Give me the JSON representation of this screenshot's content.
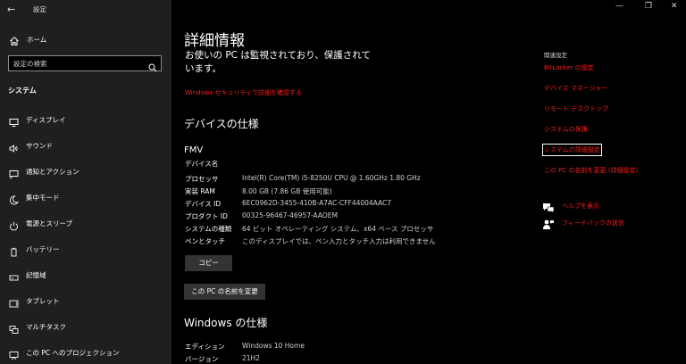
{
  "window": {
    "app_title": "設定",
    "back_glyph": "←",
    "minimize_glyph": "—",
    "maximize_glyph": "❐",
    "close_glyph": "✕"
  },
  "sidebar": {
    "home_label": "ホーム",
    "search_placeholder": "設定の検索",
    "section_title": "システム",
    "items": [
      {
        "label": "ディスプレイ",
        "icon": "display-icon"
      },
      {
        "label": "サウンド",
        "icon": "sound-icon"
      },
      {
        "label": "通知とアクション",
        "icon": "notification-icon"
      },
      {
        "label": "集中モード",
        "icon": "focus-moon-icon"
      },
      {
        "label": "電源とスリープ",
        "icon": "power-icon"
      },
      {
        "label": "バッテリー",
        "icon": "battery-icon"
      },
      {
        "label": "記憶域",
        "icon": "storage-icon"
      },
      {
        "label": "タブレット",
        "icon": "tablet-icon"
      },
      {
        "label": "マルチタスク",
        "icon": "multitask-icon"
      },
      {
        "label": "この PC へのプロジェクション",
        "icon": "projection-icon"
      }
    ]
  },
  "main": {
    "title": "詳細情報",
    "protect_text": "お使いの PC は監視されており、保護されています。",
    "security_link": "Windows セキュリティで詳細を確認する",
    "device_spec_title": "デバイスの仕様",
    "device_name": "FMV",
    "device_name_label": "デバイス名",
    "specs": [
      {
        "key": "プロセッサ",
        "value": "Intel(R) Core(TM) i5-8250U CPU @ 1.60GHz   1.80 GHz"
      },
      {
        "key": "実装 RAM",
        "value": "8.00 GB (7.86 GB 使用可能)"
      },
      {
        "key": "デバイス ID",
        "value": "6EC0962D-3455-410B-A7AC-CFF44004AAC7"
      },
      {
        "key": "プロダクト ID",
        "value": "00325-96467-46957-AAOEM"
      },
      {
        "key": "システムの種類",
        "value": "64 ビット オペレーティング システム、x64 ベース プロセッサ"
      },
      {
        "key": "ペンとタッチ",
        "value": "このディスプレイでは、ペン入力とタッチ入力は利用できません"
      }
    ],
    "copy_button": "コピー",
    "rename_button": "この PC の名前を変更",
    "windows_spec_title": "Windows の仕様",
    "win_specs": [
      {
        "key": "エディション",
        "value": "Windows 10 Home"
      },
      {
        "key": "バージョン",
        "value": "21H2"
      }
    ]
  },
  "related": {
    "title": "関連設定",
    "links": [
      "BitLocker の設定",
      "デバイス マネージャー",
      "リモート デスクトップ",
      "システムの保護",
      "システムの詳細設定",
      "この PC の名前を変更 (詳細設定)"
    ],
    "help_label": "ヘルプを表示",
    "feedback_label": "フィードバックの送信"
  },
  "colors": {
    "accent": "#ff1a1a",
    "sidebar_bg": "#1f1f1f",
    "main_bg": "#000000"
  }
}
